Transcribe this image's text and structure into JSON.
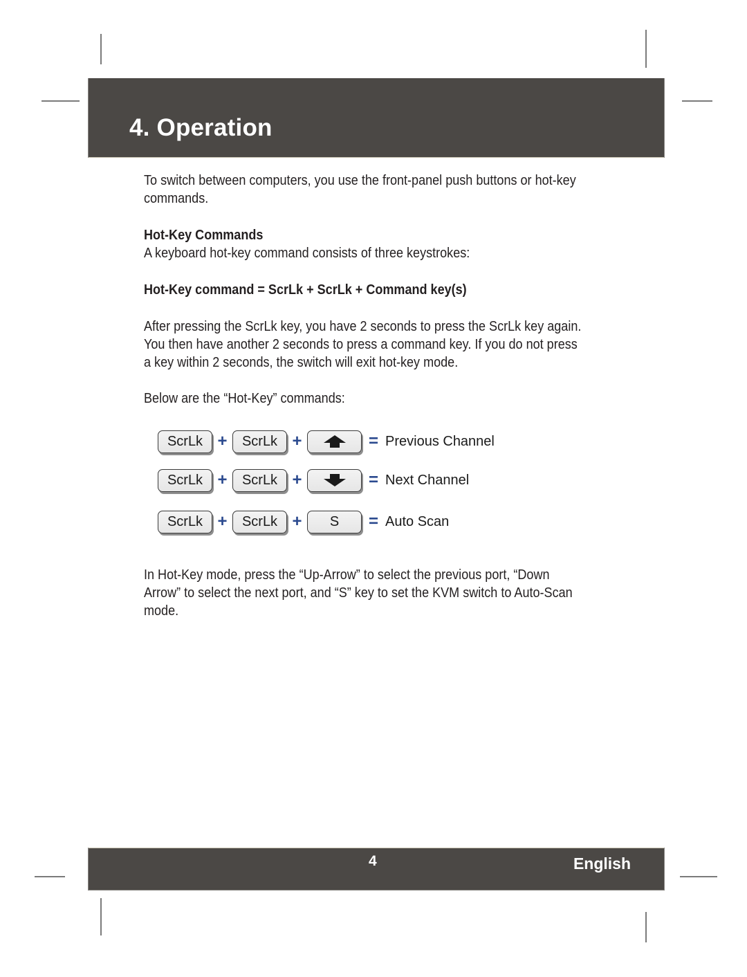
{
  "header": {
    "title": "4. Operation"
  },
  "intro": {
    "line1": "To switch between computers, you use the front-panel push buttons or hot-key",
    "line2": "commands."
  },
  "hotkey_section": {
    "heading": "Hot-Key Commands",
    "description": "A keyboard hot-key command consists of three keystrokes:",
    "formula": "Hot-Key command = ScrLk + ScrLk + Command key(s)",
    "timing_lines": [
      "After pressing the ScrLk key, you have 2 seconds to press the ScrLk key again.",
      "You then have another 2 seconds to press a command key.  If you do not press",
      "a key within 2 seconds, the switch will exit hot-key mode."
    ],
    "list_intro": "Below are the “Hot-Key” commands:"
  },
  "hotkeys": [
    {
      "keys": [
        "ScrLk",
        "ScrLk"
      ],
      "command_key_icon": "up-arrow-icon",
      "command_key_label": "",
      "plus": "+",
      "equals": "=",
      "action": "Previous Channel"
    },
    {
      "keys": [
        "ScrLk",
        "ScrLk"
      ],
      "command_key_icon": "down-arrow-icon",
      "command_key_label": "",
      "plus": "+",
      "equals": "=",
      "action": "Next Channel"
    },
    {
      "keys": [
        "ScrLk",
        "ScrLk"
      ],
      "command_key_icon": "",
      "command_key_label": "S",
      "plus": "+",
      "equals": "=",
      "action": "Auto Scan"
    }
  ],
  "explanation_lines": [
    "In Hot-Key mode, press the “Up-Arrow” to select the previous port, “Down",
    "Arrow” to select the next port, and “S” key to set the KVM switch to Auto-Scan",
    "mode."
  ],
  "footer": {
    "page_number": "4",
    "language": "English"
  },
  "colors": {
    "bar_background": "#4b4845",
    "operator_blue": "#2b4a8f",
    "body_text": "#231f20"
  }
}
